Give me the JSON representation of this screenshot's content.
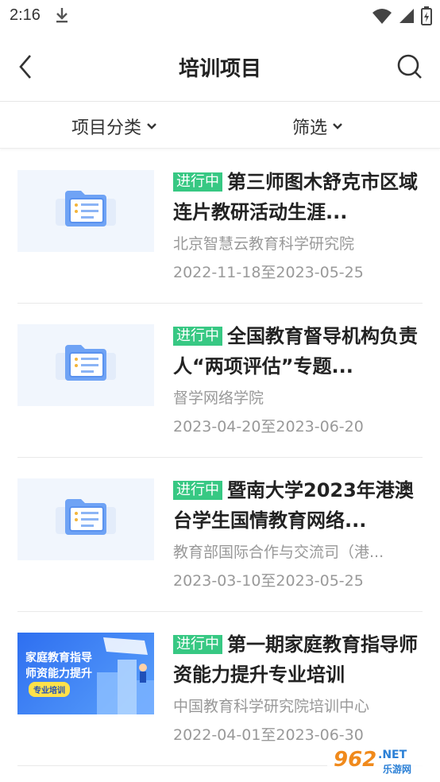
{
  "status_bar": {
    "time": "2:16"
  },
  "header": {
    "title": "培训项目"
  },
  "filters": {
    "category_label": "项目分类",
    "filter_label": "筛选"
  },
  "items": [
    {
      "status": "进行中",
      "title": "第三师图木舒克市区域连片教研活动生涯...",
      "org": "北京智慧云教育科学研究院",
      "dates": "2022-11-18至2023-05-25",
      "thumb": "folder-placeholder"
    },
    {
      "status": "进行中",
      "title": "全国教育督导机构负责人“两项评估”专题...",
      "org": "督学网络学院",
      "dates": "2023-04-20至2023-06-20",
      "thumb": "folder-placeholder"
    },
    {
      "status": "进行中",
      "title": "暨南大学2023年港澳台学生国情教育网络...",
      "org": "教育部国际合作与交流司（港...",
      "dates": "2023-03-10至2023-05-25",
      "thumb": "folder-placeholder"
    },
    {
      "status": "进行中",
      "title": "第一期家庭教育指导师资能力提升专业培训",
      "org": "中国教育科学研究院培训中心",
      "dates": "2022-04-01至2023-06-30",
      "thumb": "banner",
      "banner_line1": "家庭教育指导",
      "banner_line2": "师资能力提升",
      "banner_tag": "专业培训"
    }
  ],
  "watermark": {
    "text": "962",
    "suffix": ".NET",
    "sub": "乐游网"
  },
  "colors": {
    "badge": "#37c883",
    "accent": "#2e6ff0"
  }
}
